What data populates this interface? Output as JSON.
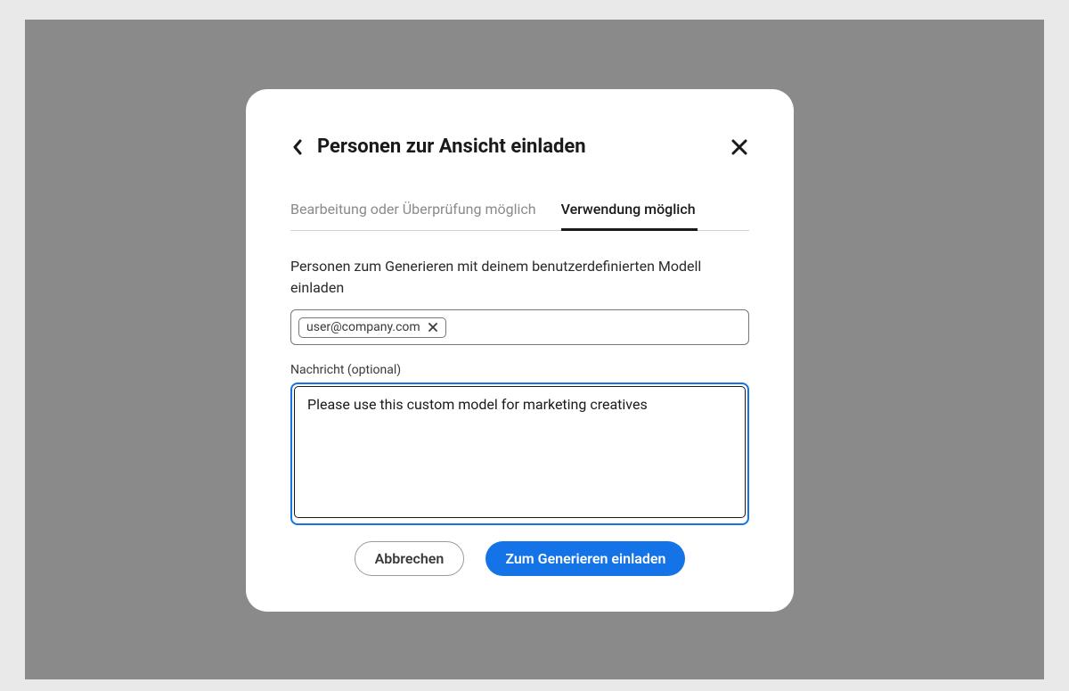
{
  "dialog": {
    "title": "Personen zur Ansicht einladen",
    "tabs": {
      "edit_review": "Bearbeitung oder Überprüfung möglich",
      "use": "Verwendung möglich"
    },
    "invite_label": "Personen zum Generieren mit deinem benutzerdefinierten Modell einladen",
    "chip_email": "user@company.com",
    "message_label": "Nachricht (optional)",
    "message_value": "Please use this custom model for marketing creatives",
    "buttons": {
      "cancel": "Abbrechen",
      "invite": "Zum Generieren einladen"
    }
  }
}
